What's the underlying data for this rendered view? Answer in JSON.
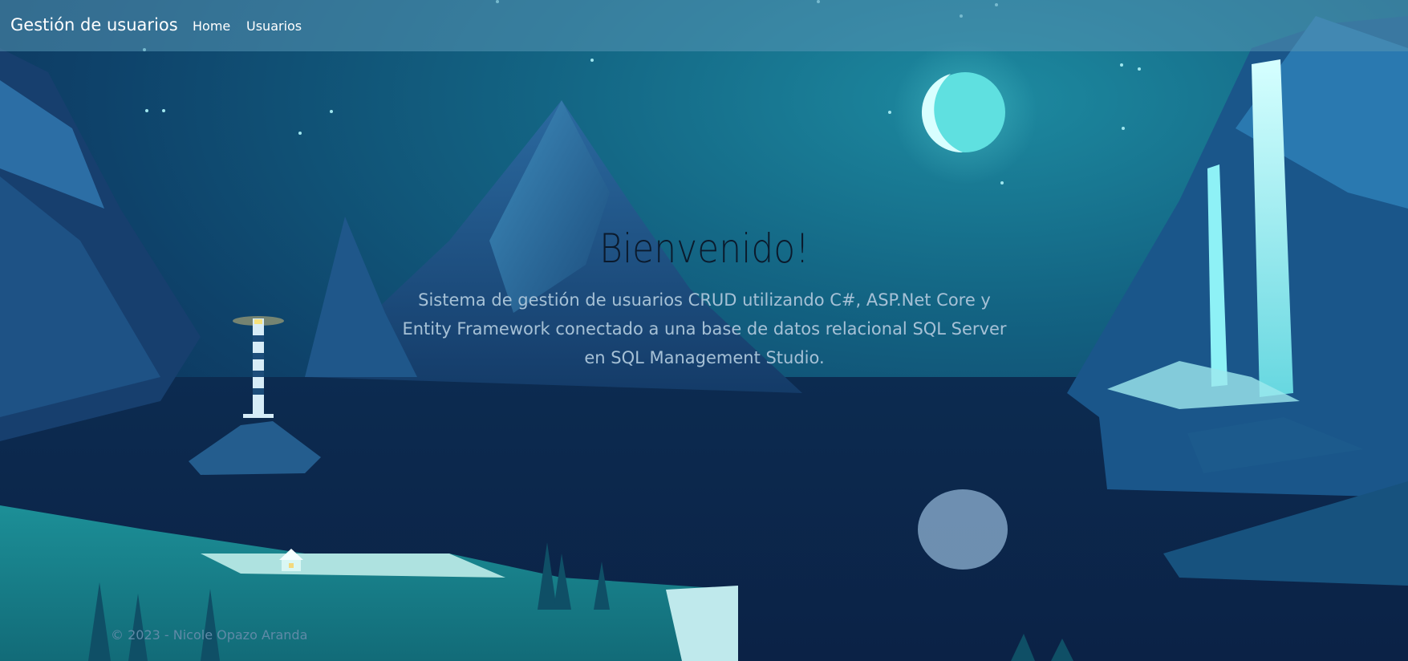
{
  "navbar": {
    "brand": "Gestión de usuarios",
    "links": [
      {
        "label": "Home"
      },
      {
        "label": "Usuarios"
      }
    ]
  },
  "hero": {
    "title": "Bienvenido!",
    "description": "Sistema de gestión de usuarios CRUD utilizando C#, ASP.Net Core y Entity Framework conectado a una base de datos relacional SQL Server en SQL Management Studio."
  },
  "footer": {
    "text": "© 2023 - Nicole Opazo Aranda"
  },
  "colors": {
    "navbar_bg": "#4f8fb0",
    "sky_top": "#0d3d66",
    "sky_mid": "#156b86",
    "water": "#0d2c52",
    "moon": "#5fe0e0"
  }
}
